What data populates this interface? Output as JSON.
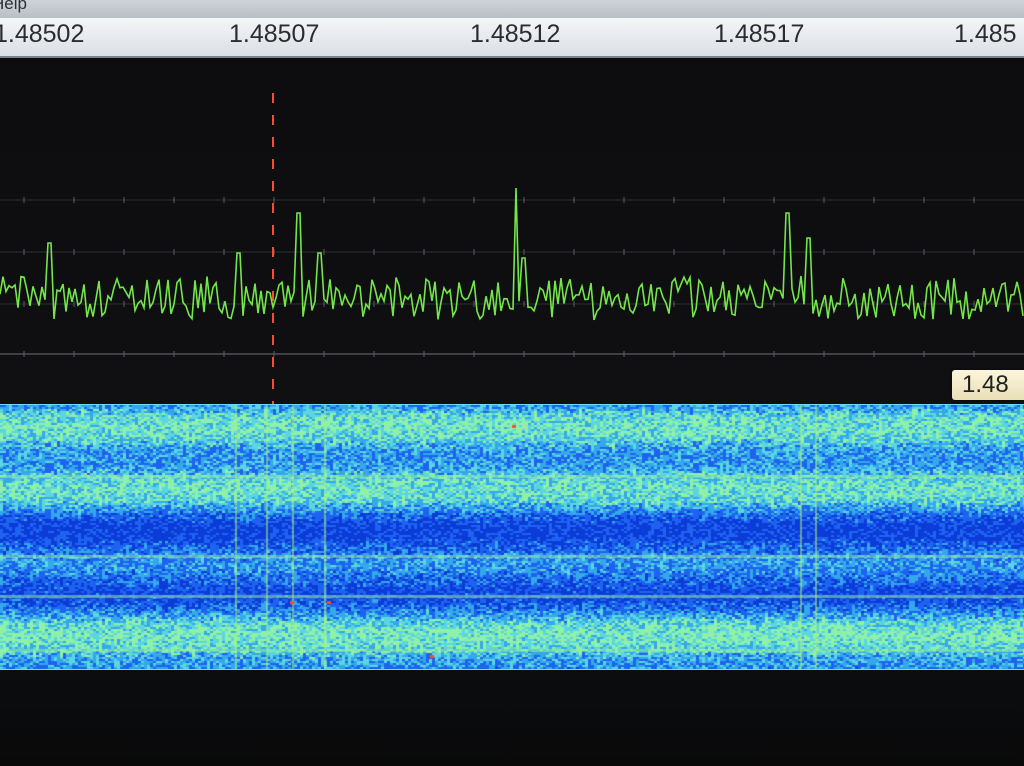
{
  "menu": {
    "help_label": "Help"
  },
  "frequency_axis": {
    "labels": [
      "1.48502",
      "1.48507",
      "1.48512",
      "1.48517",
      "1.485"
    ]
  },
  "spectrum": {
    "trace_color": "#74e64a",
    "marker_color": "#ff4a2e",
    "peak_positions_label": [
      "1.48507",
      "1.48512",
      "1.48517"
    ]
  },
  "tuning_marker": {
    "readout": "1.48"
  },
  "waterfall": {
    "palette": [
      "#0b3cd8",
      "#1e63f0",
      "#33a8ea",
      "#5bd6e0",
      "#8ff0a8",
      "#ff4a2e"
    ]
  }
}
